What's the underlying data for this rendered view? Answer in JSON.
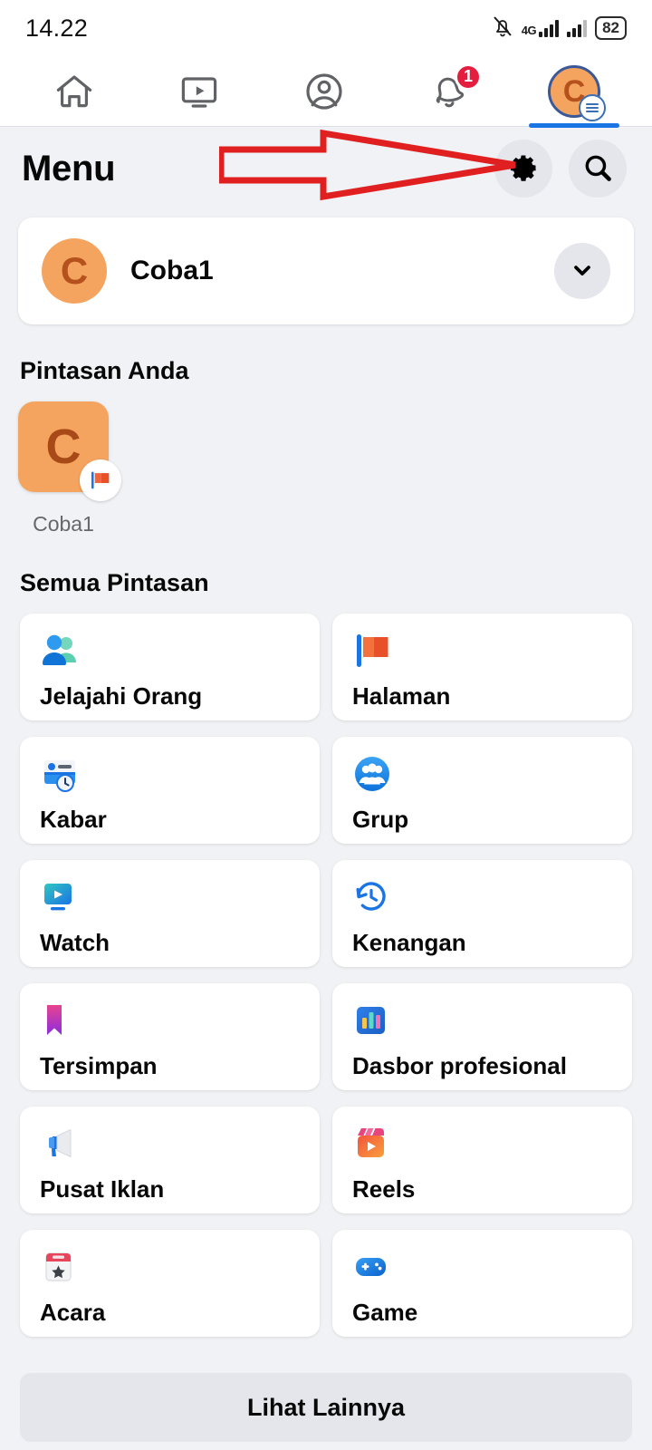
{
  "status_bar": {
    "time": "14.22",
    "battery_level": "82",
    "network_type": "4G",
    "icons": [
      "bell-muted-icon",
      "signal-4g-icon",
      "signal-bars-icon",
      "battery-icon"
    ]
  },
  "top_nav": {
    "tabs": [
      {
        "name": "home",
        "icon": "home-icon",
        "active": false,
        "badge": ""
      },
      {
        "name": "video",
        "icon": "video-icon",
        "active": false,
        "badge": ""
      },
      {
        "name": "profile",
        "icon": "profile-circle-icon",
        "active": false,
        "badge": ""
      },
      {
        "name": "notifications",
        "icon": "bell-icon",
        "active": false,
        "badge": "1"
      },
      {
        "name": "menu",
        "icon": "avatar-menu-icon",
        "active": true,
        "badge": ""
      }
    ],
    "avatar_initial": "C"
  },
  "header": {
    "title": "Menu",
    "settings_icon": "gear-icon",
    "search_icon": "search-icon"
  },
  "annotation": {
    "type": "arrow",
    "color": "#e02020",
    "points_to": "settings-button"
  },
  "account": {
    "initial": "C",
    "name": "Coba1",
    "expand_icon": "chevron-down-icon"
  },
  "your_shortcuts": {
    "title": "Pintasan Anda",
    "items": [
      {
        "initial": "C",
        "label": "Coba1",
        "badge_icon": "page-flag-icon"
      }
    ]
  },
  "all_shortcuts": {
    "title": "Semua Pintasan",
    "items": [
      {
        "label": "Jelajahi Orang",
        "icon": "friends-icon"
      },
      {
        "label": "Halaman",
        "icon": "page-flag-icon"
      },
      {
        "label": "Kabar",
        "icon": "news-feed-icon"
      },
      {
        "label": "Grup",
        "icon": "groups-icon"
      },
      {
        "label": "Watch",
        "icon": "watch-monitor-icon"
      },
      {
        "label": "Kenangan",
        "icon": "memories-clock-icon"
      },
      {
        "label": "Tersimpan",
        "icon": "saved-bookmark-icon"
      },
      {
        "label": "Dasbor profesional",
        "icon": "dashboard-chart-icon"
      },
      {
        "label": "Pusat Iklan",
        "icon": "ads-megaphone-icon"
      },
      {
        "label": "Reels",
        "icon": "reels-icon"
      },
      {
        "label": "Acara",
        "icon": "events-calendar-icon"
      },
      {
        "label": "Game",
        "icon": "gaming-controller-icon"
      }
    ]
  },
  "footer": {
    "see_more_label": "Lihat Lainnya"
  },
  "colors": {
    "background": "#f0f2f5",
    "card": "#ffffff",
    "accent_blue": "#1b74e4",
    "avatar_orange": "#f5a45f",
    "badge_red": "#e41e3f",
    "annotation_red": "#e02020"
  }
}
